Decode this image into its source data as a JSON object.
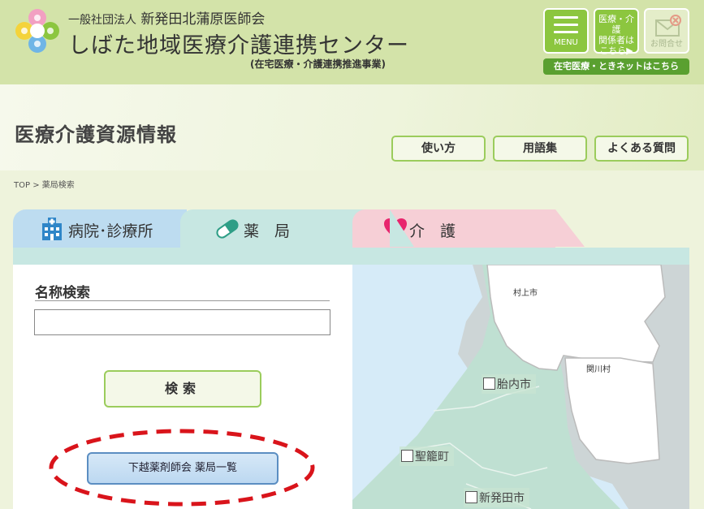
{
  "header": {
    "org_prefix": "一般社団法人",
    "org_name": "新発田北蒲原医師会",
    "center_name": "しばた地域医療介護連携センター",
    "center_subtitle": "(在宅医療・介護連携推進事業)",
    "menu_label": "MENU",
    "related_line1": "医療・介護",
    "related_line2": "関係者は",
    "related_line3": "こちら▶",
    "contact_label": "お問合せ",
    "tokinet_label": "在宅医療・ときネットはこちら"
  },
  "title": {
    "page_title": "医療介護資源情報",
    "usage_label": "使い方",
    "glossary_label": "用語集",
    "faq_label": "よくある質問"
  },
  "breadcrumb": {
    "home": "TOP",
    "sep": ">",
    "current": "薬局検索"
  },
  "tabs": [
    {
      "label": "病院･診療所"
    },
    {
      "label": "薬　局"
    },
    {
      "label": "介　護"
    }
  ],
  "search": {
    "label": "名称検索",
    "value": "",
    "placeholder": "",
    "button_label": "検索",
    "list_button_label": "下越薬剤師会 薬局一覧"
  },
  "map": {
    "areas": [
      {
        "label": "胎内市"
      },
      {
        "label": "聖籠町"
      },
      {
        "label": "新発田市"
      }
    ],
    "small_labels": [
      {
        "label": "村上市"
      },
      {
        "label": "関川村"
      }
    ]
  },
  "colors": {
    "header_bg": "#d3e3a9",
    "accent_green": "#8cc63f",
    "tab_hospital": "#bddcf0",
    "tab_pharmacy": "#c7e7e2",
    "tab_care": "#f6cfd6",
    "highlight_dashes": "#d9141b"
  }
}
